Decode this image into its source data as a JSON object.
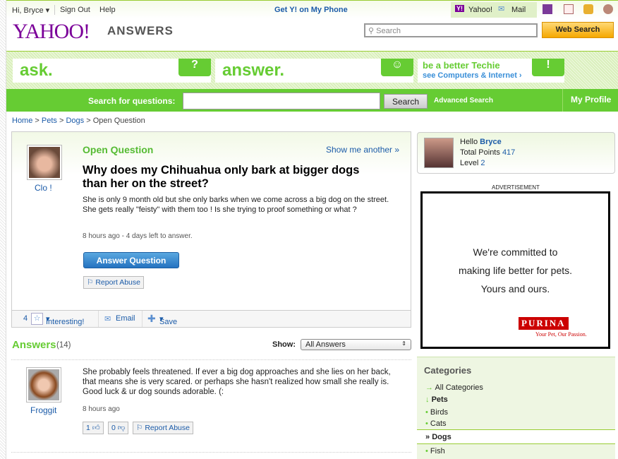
{
  "topbar": {
    "greeting": "Hi, Bryce",
    "sign_out": "Sign Out",
    "help": "Help",
    "phone": "Get Y! on My Phone",
    "yahoo": "Yahoo!",
    "mail": "Mail"
  },
  "header": {
    "logo": "YAHOO!",
    "logo_sub": "ANSWERS",
    "search_placeholder": "Search",
    "web_search": "Web Search"
  },
  "promos": {
    "ask": "ask.",
    "answer": "answer.",
    "techie_title": "be a better Techie",
    "techie_link": "see Computers & Internet ›"
  },
  "searchbar": {
    "label": "Search for questions:",
    "button": "Search",
    "advanced": "Advanced Search",
    "profile": "My Profile"
  },
  "breadcrumb": {
    "home": "Home",
    "pets": "Pets",
    "dogs": "Dogs",
    "current": "Open Question",
    "sep": ">"
  },
  "question": {
    "status": "Open Question",
    "show_another": "Show me another »",
    "asker": "Clo !",
    "title": "Why does my Chihuahua only bark at bigger dogs than her on the street?",
    "body": "She is only 9 month old but she only barks when we come across a big dog on the street. She gets really \"feisty\" with them too ! Is she trying to proof something or what ?",
    "meta": "8 hours ago - 4 days left to answer.",
    "answer_button": "Answer Question",
    "report": "Report Abuse",
    "interesting_count": "4",
    "interesting": "Interesting!",
    "email": "Email",
    "save": "Save"
  },
  "answers": {
    "title": "Answers",
    "count": "(14)",
    "show_label": "Show:",
    "show_value": "All Answers",
    "items": [
      {
        "user": "Froggit",
        "text": "She probably feels threatened. If ever a big dog approaches and she lies on her back, that means she is very scared. or perhaps she hasn't realized how small she really is. Good luck & ur dog sounds adorable. (:",
        "time": "8 hours ago",
        "up": "1",
        "down": "0",
        "report": "Report Abuse"
      }
    ]
  },
  "profile": {
    "hello": "Hello",
    "name": "Bryce",
    "points_label": "Total Points",
    "points": "417",
    "level_label": "Level",
    "level": "2"
  },
  "ad": {
    "label": "ADVERTISEMENT",
    "line1": "We're committed to",
    "line2": "making life better for pets.",
    "line3": "Yours and ours.",
    "brand": "PURINA",
    "tagline": "Your Pet, Our Passion."
  },
  "categories": {
    "title": "Categories",
    "items": [
      "All Categories",
      "Pets",
      "Birds",
      "Cats",
      "Dogs",
      "Fish"
    ]
  },
  "colors": {
    "green": "#66cc33",
    "purple": "#7b0099",
    "link": "#1b5ba8"
  }
}
